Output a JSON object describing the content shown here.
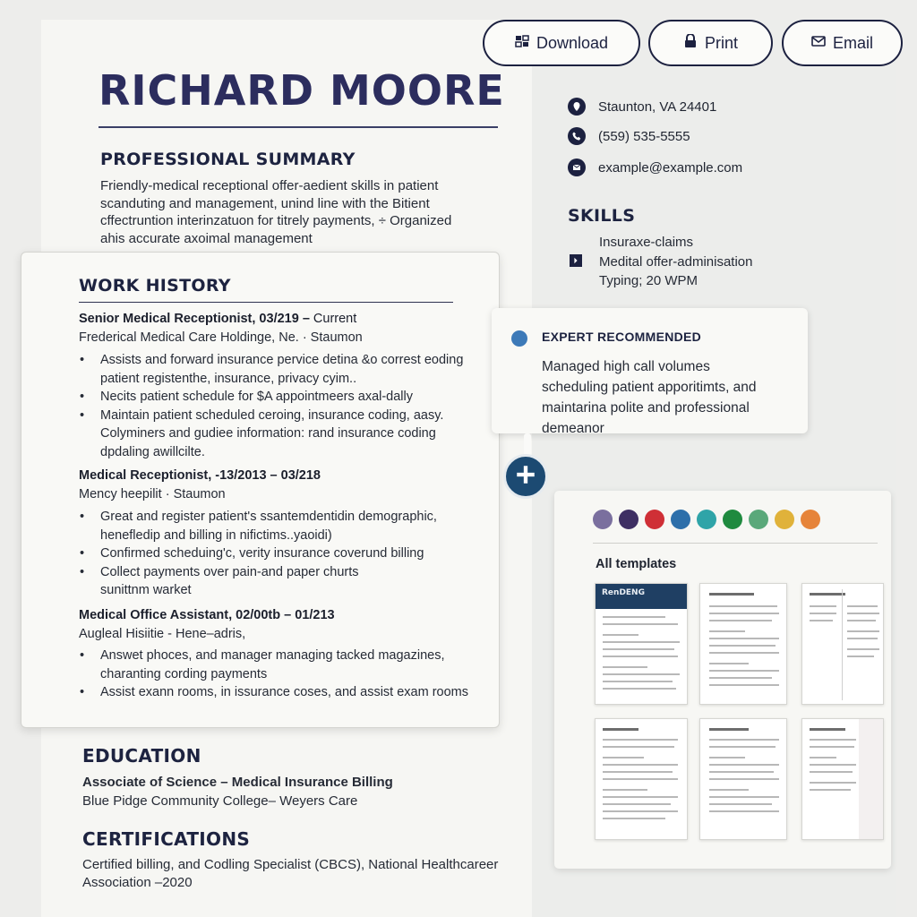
{
  "toolbar": {
    "download_label": "Download",
    "print_label": "Print",
    "email_label": "Email"
  },
  "resume": {
    "name": "RICHARD MOORE",
    "summary": {
      "heading": "PROFESSIONAL SUMMARY",
      "lines": [
        "Friendly-medical receptional offer-aedient skills in patient",
        "scanduting and management, unind line with the Bitient",
        "cffectruntion interinzatuon for titrely payments, ÷ Organized",
        "ahis accurate axoimal management"
      ]
    },
    "contact": {
      "address": "Staunton, VA 24401",
      "phone": "(559) 535-5555",
      "email": "example@example.com"
    },
    "skills": {
      "heading": "SKILLS",
      "items": [
        "Insuraxe-claims",
        "Medital offer-adminisation",
        "Typing; 20 WPM"
      ]
    },
    "work": {
      "heading": "WORK HISTORY",
      "jobs": [
        {
          "title": "Senior Medical Receptionist, 03/219 –",
          "current": " Current",
          "company": "Frederical Medical Care Holdinge, Ne. · Staumon",
          "bullets": [
            "Assists and forward insurance pervice detina &o correst eoding",
            "patient registenthe, insurance, privacy cyim..",
            "Necits patient schedule for $A appointmeers axal-dally",
            "Maintain patient scheduled ceroing, insurance coding, aasy.",
            "Colyminers and gudiee information: rand insurance coding",
            "dpdaling awillcilte."
          ]
        },
        {
          "title": "Medical Receptionist, -13/2013 – 03/218",
          "current": "",
          "company": "Mency heepilit · Staumon",
          "bullets": [
            "Great and register patient's ssantemdentidin demographic,",
            "henefledip and billing in nifictims..yaoidi)",
            "Confirmed scheduing'c, verity insurance coverund billing",
            "Collect payments over pain-and paper churts",
            "sunittnm warket"
          ]
        },
        {
          "title": "Medical Office Assistant, 02/00tb – 01/213",
          "current": "",
          "company": "Augleal Hisiitie - Hene–adris,",
          "bullets": [
            "Answet phoces, and manager managing tacked magazines,",
            "charanting cording payments",
            "Assist exann rooms, in issurance coses, and assist exam rooms"
          ]
        }
      ]
    },
    "education": {
      "heading": "EDUCATION",
      "degree": "Associate of Science – Medical Insurance Billing",
      "school": "Blue Pidge Community College– Weyers Care"
    },
    "certifications": {
      "heading": "CERTIFICATIONS",
      "lines": [
        "Certified billing, and Codling Specialist (CBCS), National Healthcareer",
        "Association –2020"
      ]
    }
  },
  "expert": {
    "label": "EXPERT RECOMMENDED",
    "lines": [
      "Managed high call volumes",
      "scheduling patient apporitimts, and",
      "maintarina polite and professional",
      "demeanor"
    ]
  },
  "templates_panel": {
    "label": "All templates",
    "colors": [
      "#7a6f9e",
      "#3e2f63",
      "#cf2f36",
      "#2d6faa",
      "#2fa4a8",
      "#1f8a3f",
      "#5aa87a",
      "#e0b23a",
      "#e6843a"
    ],
    "cards": [
      {
        "header_text": "RenDENG"
      },
      {
        "header_text": ""
      },
      {
        "header_text": ""
      },
      {
        "header_text": ""
      },
      {
        "header_text": ""
      },
      {
        "header_text": ""
      }
    ]
  },
  "icons": {
    "download": "download-icon",
    "print": "print-icon",
    "email": "email-icon",
    "location": "location-icon",
    "phone": "phone-icon",
    "mail": "mail-icon",
    "skill_marker": "arrow-right-icon",
    "add": "plus-icon"
  }
}
